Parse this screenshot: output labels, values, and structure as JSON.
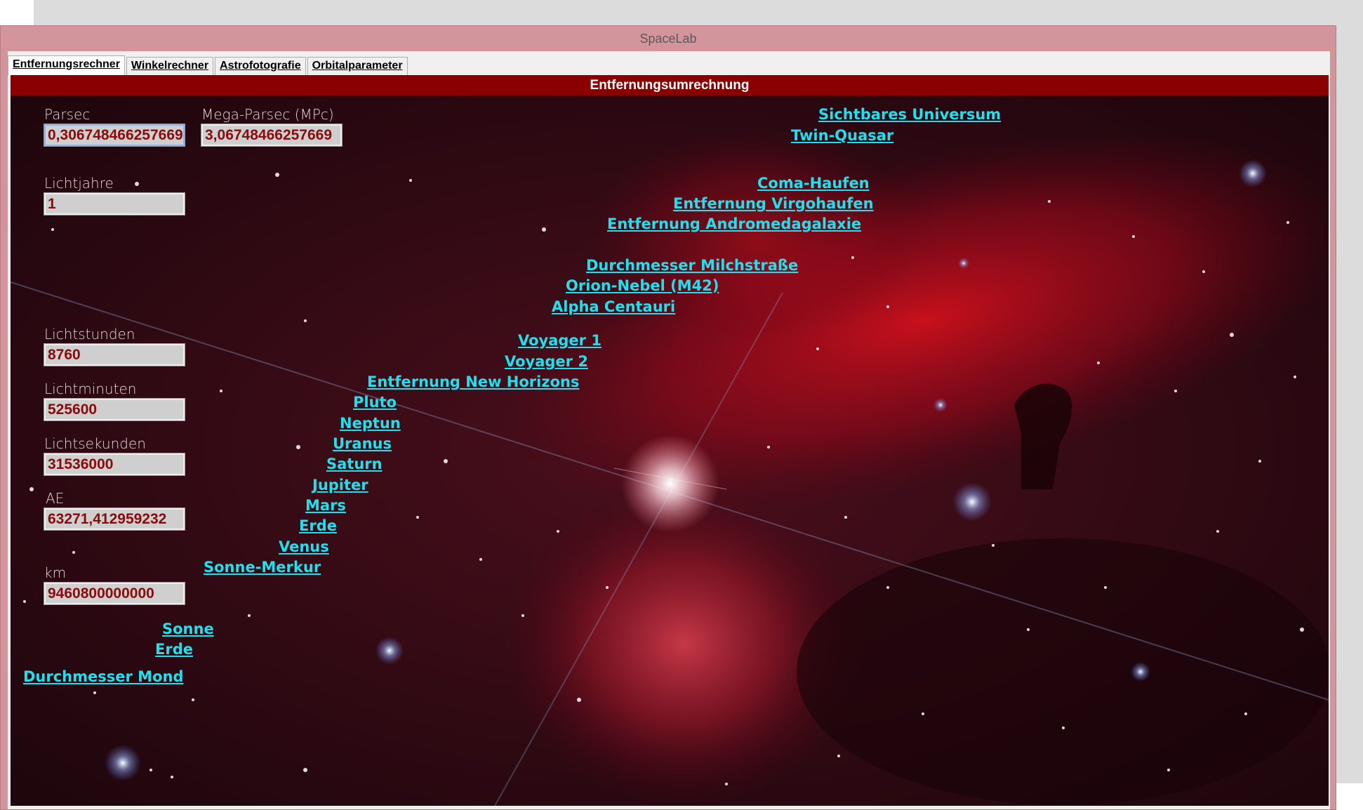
{
  "window": {
    "title": "SpaceLab"
  },
  "tabs": [
    {
      "label": "Entfernungsrechner"
    },
    {
      "label": "Winkelrechner"
    },
    {
      "label": "Astrofotografie"
    },
    {
      "label": "Orbitalparameter"
    }
  ],
  "panel": {
    "header": "Entfernungsumrechnung"
  },
  "fields": {
    "parsec": {
      "label": "Parsec",
      "value": "0,306748466257669"
    },
    "megaparsec": {
      "label": "Mega-Parsec (MPc)",
      "value": "3,06748466257669"
    },
    "lichtjahre": {
      "label": "Lichtjahre",
      "value": "1"
    },
    "lichtstunden": {
      "label": "Lichtstunden",
      "value": "8760"
    },
    "lichtminuten": {
      "label": "Lichtminuten",
      "value": "525600"
    },
    "lichtsekunden": {
      "label": "Lichtsekunden",
      "value": "31536000"
    },
    "ae": {
      "label": "AE",
      "value": "63271,412959232"
    },
    "km": {
      "label": "km",
      "value": "9460800000000"
    }
  },
  "links": {
    "sichtbares_universum": "Sichtbares Universum",
    "twin_quasar": "Twin-Quasar",
    "coma_haufen": "Coma-Haufen",
    "virgohaufen": "Entfernung Virgohaufen",
    "andromeda": "Entfernung Andromedagalaxie",
    "milchstrasse": "Durchmesser Milchstraße",
    "orion_nebel": "Orion-Nebel (M42)",
    "alpha_centauri": "Alpha Centauri",
    "voyager1": "Voyager 1",
    "voyager2": "Voyager 2",
    "new_horizons": "Entfernung New Horizons",
    "pluto": "Pluto",
    "neptun": "Neptun",
    "uranus": "Uranus",
    "saturn": "Saturn",
    "jupiter": "Jupiter",
    "mars": "Mars",
    "erde": "Erde",
    "venus": "Venus",
    "sonne_merkur": "Sonne-Merkur",
    "sonne": "Sonne",
    "erde2": "Erde",
    "durchmesser_mond": "Durchmesser Mond"
  },
  "colors": {
    "header_bg": "#8a0000",
    "link": "#1ee0ee",
    "field_text": "#8b0a0a",
    "window_frame": "#d4949c"
  }
}
